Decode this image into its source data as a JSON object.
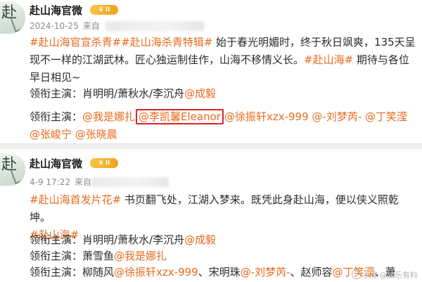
{
  "posts": [
    {
      "author": "赴山海官微",
      "badge": "II",
      "time": "2024-10-25",
      "source_prefix": "来自",
      "body_line1_tags": [
        "#赴山海官宣杀青#",
        "#赴山海杀青特辑#"
      ],
      "body_line1_text": " 始于春光明媚时，终于秋日飒爽，135天呈",
      "body_line2_text": "现不一样的江湖武林。匠心独运制佳作，山海不移情义长。",
      "body_line2_tag": "#赴山海#",
      "body_line2_tail": " 期待与各位",
      "body_line3_text": "早日相见~",
      "cast": [
        {
          "label": "领衔主演：",
          "plain": "肖明明/萧秋水/李沉舟",
          "mentions": [
            "@成毅"
          ]
        },
        {
          "label": "领衔主演：",
          "plain": "",
          "mentions": [
            "@我是娜扎",
            "@李凯馨Eleanor",
            "@徐振轩xzx-999",
            "@-刘梦芮-",
            "@丁笑滢"
          ],
          "highlighted_index": 1
        },
        {
          "label": "",
          "plain": "",
          "mentions": [
            "@张峻宁",
            "@张晓晨"
          ]
        }
      ]
    },
    {
      "author": "赴山海官微",
      "badge": "II",
      "time": "4-9 17:22",
      "source_prefix": "来自",
      "body_line1_tag": "#赴山海首发片花#",
      "body_line1_text": " 书页翻飞处，江湖入梦来。既凭此身赴山海，便以侠义照乾",
      "body_line2_text": "坤。",
      "body_line3_tag": "#赴山海#",
      "cast": [
        {
          "label": "领衔主演：",
          "plain": "肖明明/萧秋水/李沉舟",
          "mentions": [
            "@成毅"
          ]
        },
        {
          "label": "领衔主演：",
          "plain": "萧雪鱼",
          "mentions": [
            "@我是娜扎"
          ]
        },
        {
          "label": "领衔主演：",
          "plain": "柳随风",
          "mentions": [
            "@徐振轩xzx-999"
          ],
          "plain2": "、宋明珠",
          "mentions2": [
            "@-刘梦芮-"
          ],
          "plain3": "、赵师容",
          "mentions3": [
            "@丁笑滢"
          ],
          "tail": "、萧"
        }
      ]
    }
  ],
  "watermark": "头条@娱乐有料",
  "colors": {
    "link": "#e86b1f",
    "highlight_box": "#d9252b",
    "badge": "#f0a31c"
  },
  "icons": {
    "avatar": "ink-painting-avatar",
    "badge": "crown-badge-icon"
  }
}
